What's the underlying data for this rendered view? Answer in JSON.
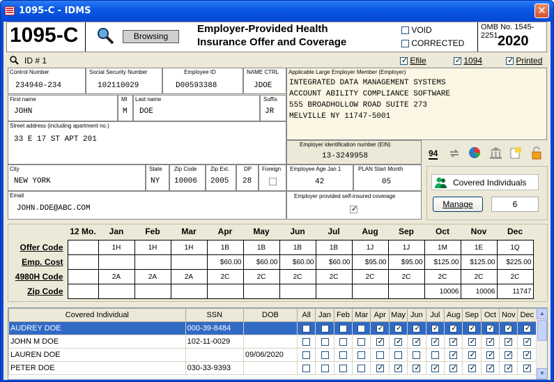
{
  "window": {
    "title": "1095-C - IDMS",
    "close": "✕"
  },
  "header": {
    "form": "1095-C",
    "browsing": "Browsing",
    "title1": "Employer-Provided Health",
    "title2": "Insurance Offer and Coverage",
    "void": "VOID",
    "corrected": "CORRECTED",
    "omb": "OMB No. 1545-2251",
    "year": "2020"
  },
  "idrow": {
    "id": "ID # 1",
    "efile": "Efile",
    "f1094": "1094",
    "printed": "Printed"
  },
  "employee": {
    "control_label": "Control Number",
    "control": "234940-234",
    "ssn_label": "Social Security Number",
    "ssn": "102110029",
    "empid_label": "Employee ID",
    "empid": "D00593388",
    "namectrl_label": "NAME CTRL",
    "namectrl": "JDOE",
    "first_label": "First name",
    "first": "JOHN",
    "mi_label": "MI",
    "mi": "M",
    "last_label": "Last name",
    "last": "DOE",
    "suffix_label": "Suffix",
    "suffix": "JR",
    "street_label": "Street address (including apartment no.)",
    "street": "33 E 17 ST APT 201",
    "city_label": "City",
    "city": "NEW YORK",
    "state_label": "State",
    "state": "NY",
    "zip_label": "Zip Code",
    "zip": "10006",
    "zipext_label": "Zip Ext.",
    "zipext": "2005",
    "dp_label": "DP",
    "dp": "28",
    "foreign_label": "Foreign",
    "email_label": "Email",
    "email": "JOHN.DOE@ABC.COM"
  },
  "employer": {
    "label": "Applicable Large Employer Member (Employer)",
    "line1": "INTEGRATED DATA MANAGEMENT SYSTEMS",
    "line2": "ACCOUNT ABILITY COMPLIANCE SOFTWARE",
    "line3": "555 BROADHOLLOW ROAD SUITE 273",
    "line4": "MELVILLE NY 11747-5001",
    "ein_label": "Employer identification number (EIN)",
    "ein": "13-3249958",
    "age_label": "Employee Age Jan 1",
    "age": "42",
    "plan_label": "PLAN Start Month",
    "plan": "05",
    "selfins_label": "Employer provided self-insured coverage"
  },
  "tools": {
    "t94": "94",
    "covered_btn": "Covered Individuals",
    "manage_btn": "Manage",
    "count": "6"
  },
  "months": [
    "12 Mo.",
    "Jan",
    "Feb",
    "Mar",
    "Apr",
    "May",
    "Jun",
    "Jul",
    "Aug",
    "Sep",
    "Oct",
    "Nov",
    "Dec"
  ],
  "offer": {
    "rows": [
      {
        "label": "Offer Code",
        "cells": [
          "",
          "1H",
          "1H",
          "1H",
          "1B",
          "1B",
          "1B",
          "1B",
          "1J",
          "1J",
          "1M",
          "1E",
          "1Q"
        ]
      },
      {
        "label": "Emp. Cost",
        "cells": [
          "",
          "",
          "",
          "",
          "$60.00",
          "$60.00",
          "$60.00",
          "$60.00",
          "$95.00",
          "$95.00",
          "$125.00",
          "$125.00",
          "$225.00"
        ]
      },
      {
        "label": "4980H Code",
        "cells": [
          "",
          "2A",
          "2A",
          "2A",
          "2C",
          "2C",
          "2C",
          "2C",
          "2C",
          "2C",
          "2C",
          "2C",
          "2C"
        ]
      },
      {
        "label": "Zip Code",
        "cells": [
          "",
          "",
          "",
          "",
          "",
          "",
          "",
          "",
          "",
          "",
          "10006",
          "10006",
          "11747"
        ]
      }
    ]
  },
  "covered": {
    "headers": [
      "Covered Individual",
      "SSN",
      "DOB",
      "All",
      "Jan",
      "Feb",
      "Mar",
      "Apr",
      "May",
      "Jun",
      "Jul",
      "Aug",
      "Sep",
      "Oct",
      "Nov",
      "Dec"
    ],
    "rows": [
      {
        "name": "AUDREY DOE",
        "ssn": "000-39-8484",
        "dob": "",
        "checks": [
          0,
          0,
          0,
          0,
          1,
          1,
          1,
          1,
          1,
          1,
          1,
          1,
          1
        ]
      },
      {
        "name": "JOHN M DOE",
        "ssn": "102-11-0029",
        "dob": "",
        "checks": [
          0,
          0,
          0,
          0,
          1,
          1,
          1,
          1,
          1,
          1,
          1,
          1,
          1
        ]
      },
      {
        "name": "LAUREN DOE",
        "ssn": "",
        "dob": "09/06/2020",
        "checks": [
          0,
          0,
          0,
          0,
          0,
          0,
          0,
          0,
          1,
          1,
          1,
          1,
          1
        ]
      },
      {
        "name": "PETER DOE",
        "ssn": "030-33-9393",
        "dob": "",
        "checks": [
          0,
          0,
          0,
          0,
          1,
          1,
          1,
          1,
          1,
          1,
          1,
          1,
          1
        ]
      }
    ]
  }
}
